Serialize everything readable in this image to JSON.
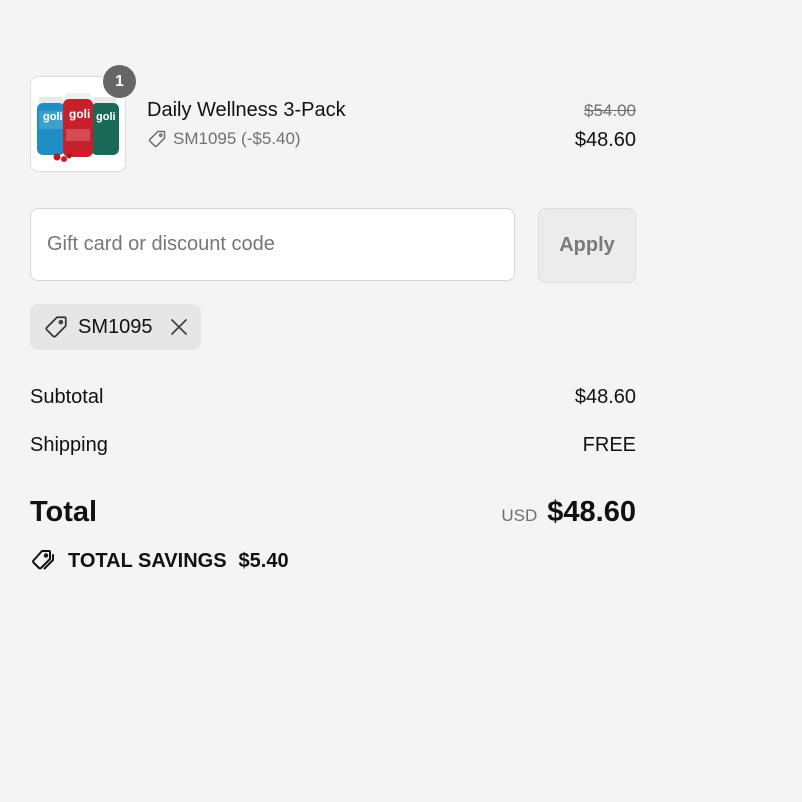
{
  "line_item": {
    "quantity": "1",
    "title": "Daily Wellness 3-Pack",
    "discount_text": "SM1095 (-$5.40)",
    "price_original": "$54.00",
    "price_final": "$48.60",
    "image_bottle_labels": [
      "goli",
      "goli",
      "goli"
    ]
  },
  "discount_form": {
    "placeholder": "Gift card or discount code",
    "value": "",
    "apply_label": "Apply"
  },
  "applied_code": {
    "code": "SM1095"
  },
  "summary": {
    "subtotal_label": "Subtotal",
    "subtotal_value": "$48.60",
    "shipping_label": "Shipping",
    "shipping_value": "FREE",
    "total_label": "Total",
    "currency": "USD",
    "total_value": "$48.60",
    "savings_label": "TOTAL SAVINGS",
    "savings_value": "$5.40"
  },
  "icons": {
    "tag": "tag-icon",
    "close": "close-icon",
    "tags": "tags-icon"
  },
  "colors": {
    "background": "#f4f4f4",
    "badge": "#666666",
    "muted_text": "#707070",
    "bottle_blue": "#1d8fc4",
    "bottle_red": "#c8202a",
    "bottle_green": "#1a6a5a"
  }
}
